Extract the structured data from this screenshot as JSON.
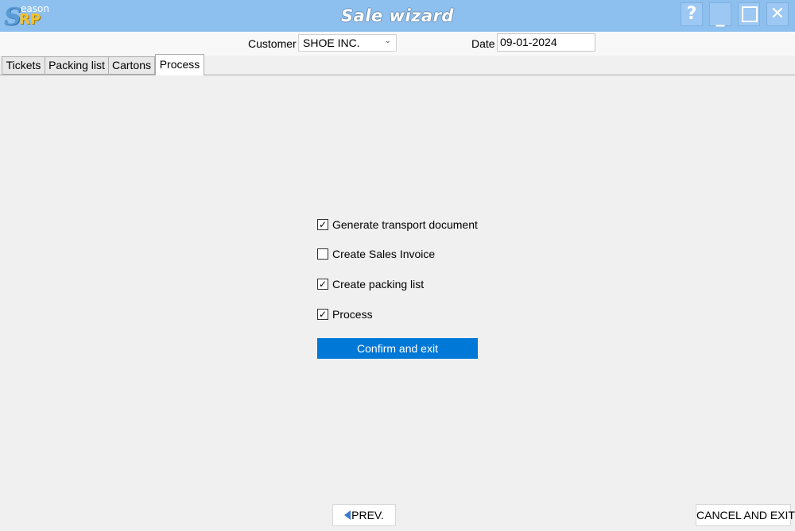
{
  "app": {
    "logo_text": "SRP",
    "logo_small_text": "eason",
    "title": "Sale wizard",
    "window_buttons": {
      "help": "?",
      "minimize": "_",
      "close": "✕"
    }
  },
  "header": {
    "customer_label": "Customer",
    "customer_value": "SHOE INC.",
    "date_label": "Date",
    "date_value": "09-01-2024"
  },
  "tabs": [
    {
      "label": "Tickets",
      "active": false
    },
    {
      "label": "Packing list",
      "active": false
    },
    {
      "label": "Cartons",
      "active": false
    },
    {
      "label": "Process",
      "active": true
    }
  ],
  "process": {
    "options": [
      {
        "label": "Generate transport document",
        "checked": true
      },
      {
        "label": "Create Sales Invoice",
        "checked": false
      },
      {
        "label": "Create packing list",
        "checked": true
      },
      {
        "label": "Process",
        "checked": true
      }
    ],
    "confirm_label": "Confirm and exit"
  },
  "footer": {
    "prev_label": "PREV.",
    "cancel_label": "CANCEL AND EXIT"
  },
  "colors": {
    "titlebar": "#8ec0ef",
    "accent": "#0078d7"
  }
}
